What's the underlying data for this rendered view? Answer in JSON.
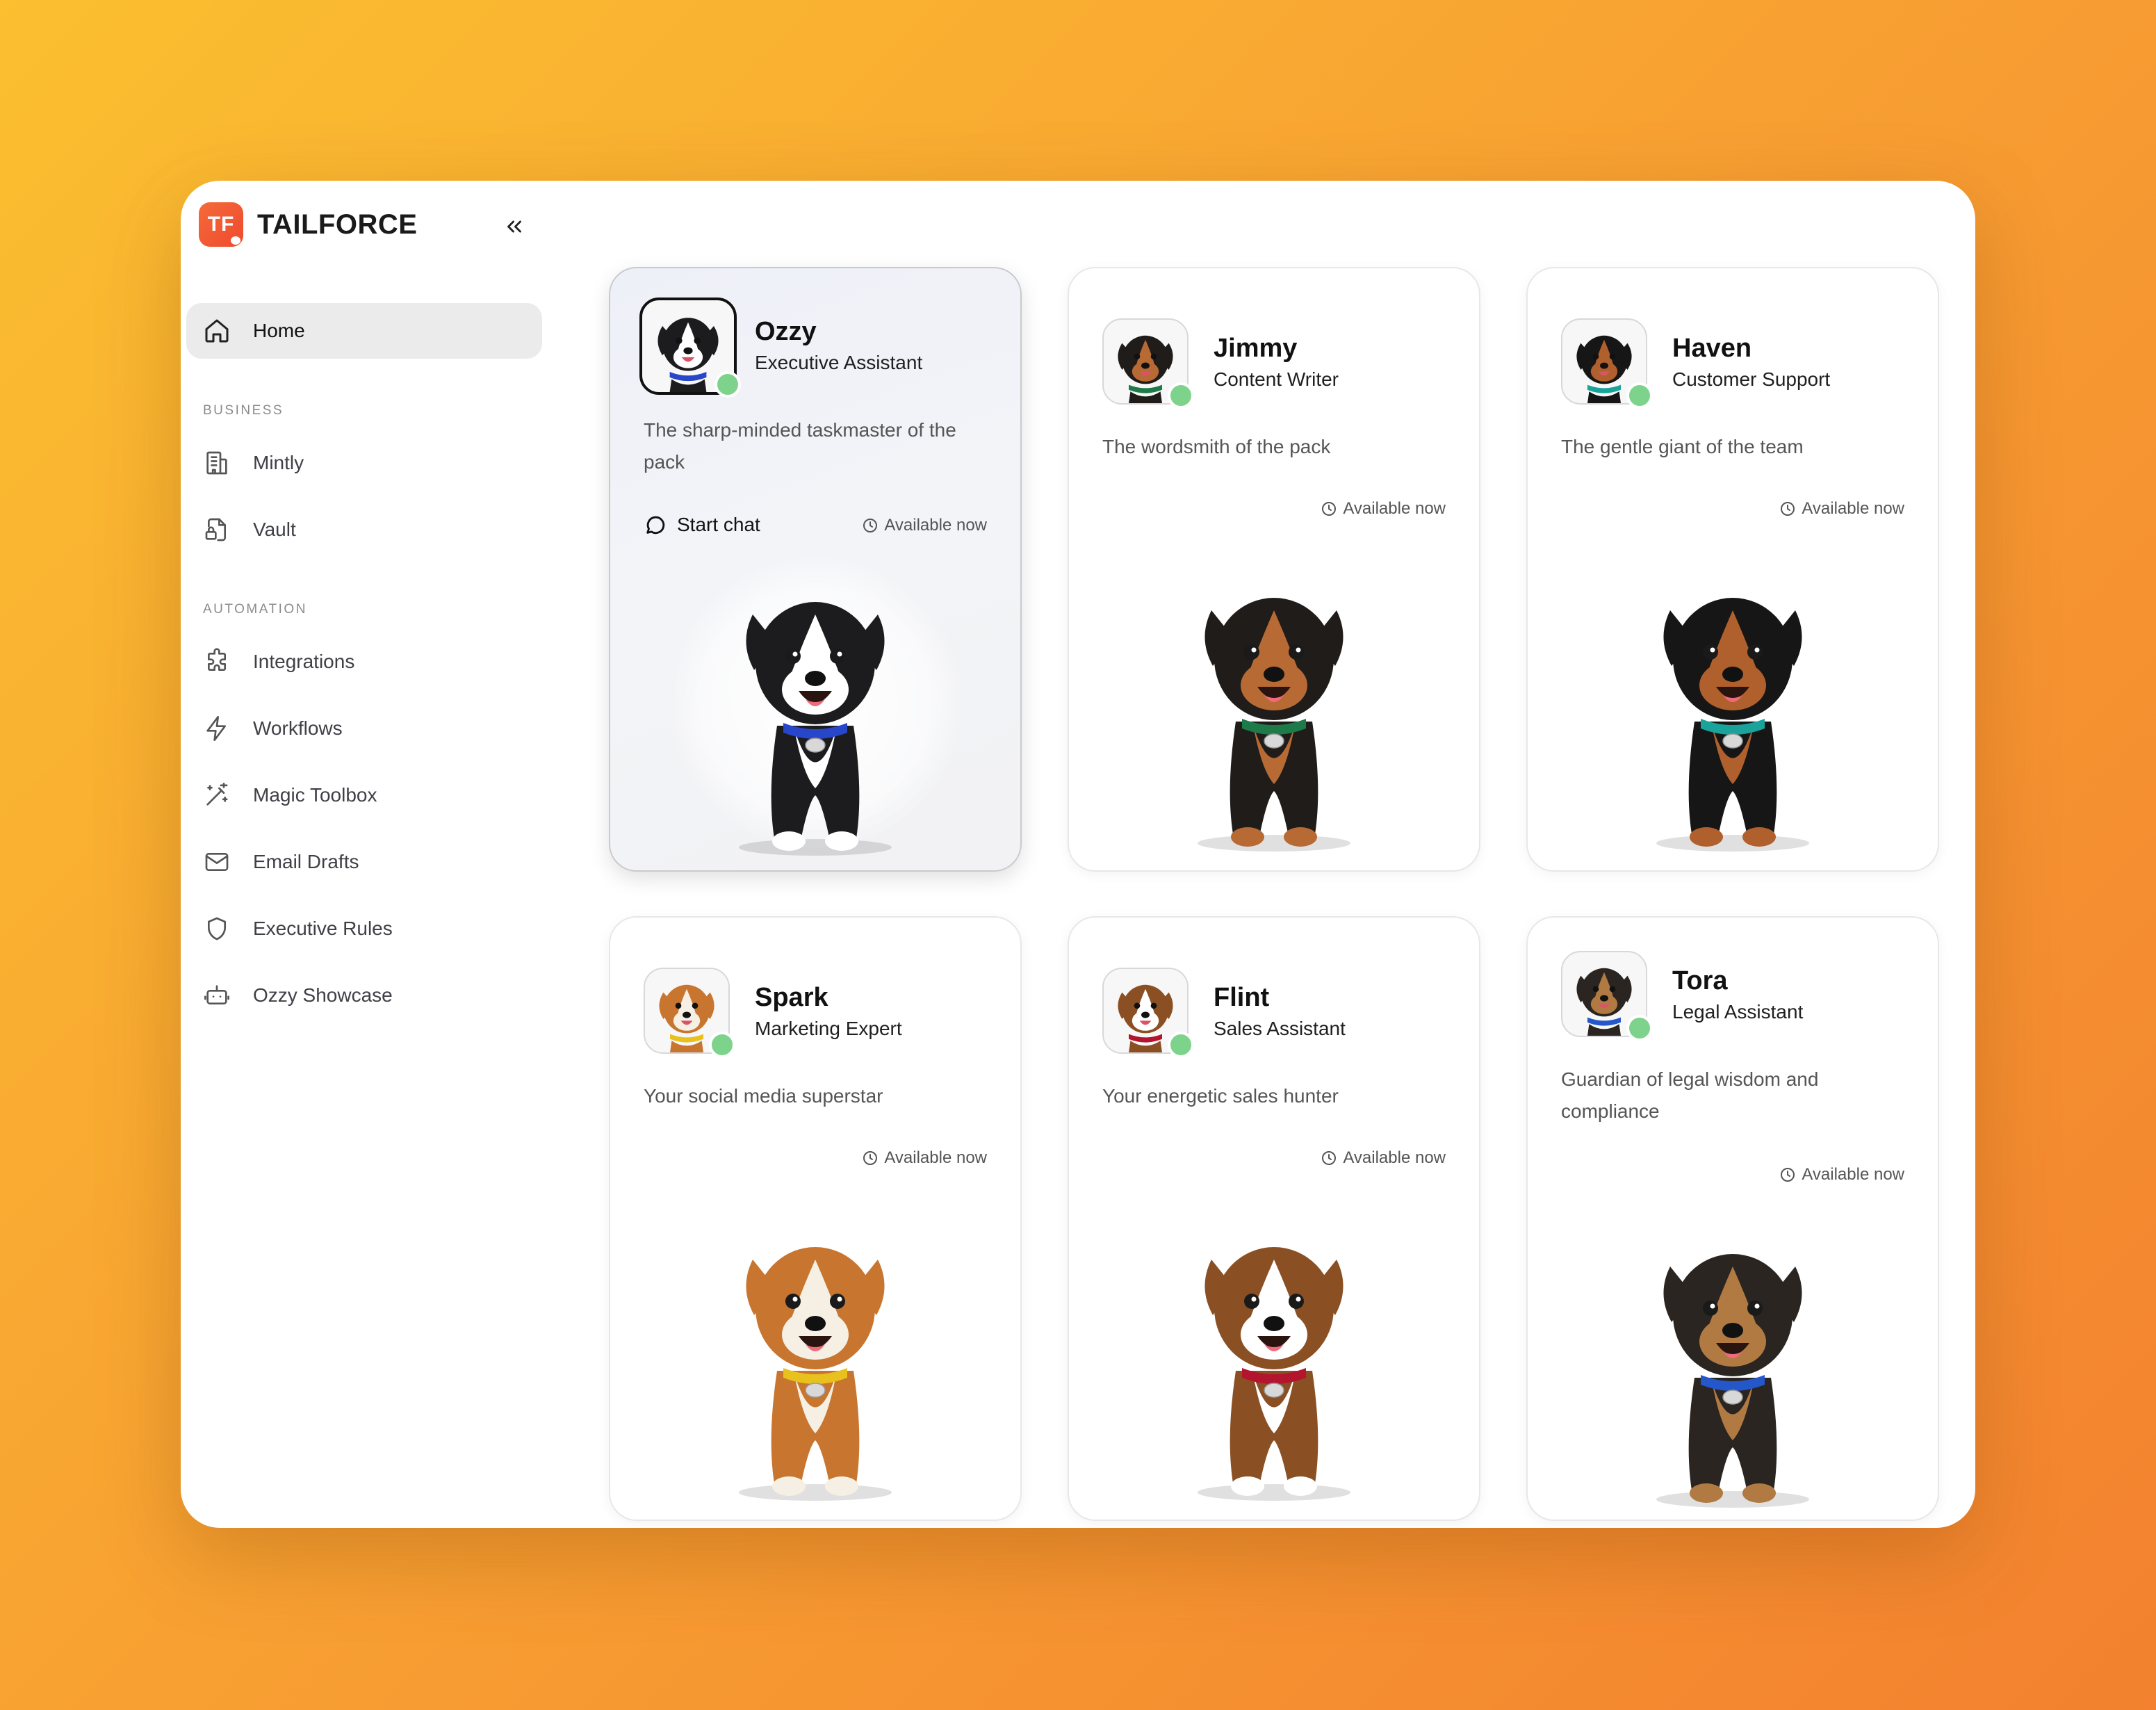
{
  "brand": {
    "logo_text": "TF",
    "name": "TAILFORCE"
  },
  "sidebar": {
    "collapse_icon": "chevrons-left-icon",
    "home": {
      "label": "Home",
      "icon": "home-icon"
    },
    "sections": [
      {
        "label": "BUSINESS",
        "items": [
          {
            "label": "Mintly",
            "icon": "building-icon"
          },
          {
            "label": "Vault",
            "icon": "file-lock-icon"
          }
        ]
      },
      {
        "label": "AUTOMATION",
        "items": [
          {
            "label": "Integrations",
            "icon": "puzzle-icon"
          },
          {
            "label": "Workflows",
            "icon": "lightning-icon"
          },
          {
            "label": "Magic Toolbox",
            "icon": "magic-wand-icon"
          },
          {
            "label": "Email Drafts",
            "icon": "mail-icon"
          },
          {
            "label": "Executive Rules",
            "icon": "shield-icon"
          },
          {
            "label": "Ozzy Showcase",
            "icon": "bot-icon"
          }
        ]
      }
    ]
  },
  "agents": [
    {
      "name": "Ozzy",
      "role": "Executive Assistant",
      "description": "The sharp-minded taskmaster of the pack",
      "availability": "Available now",
      "chat_label": "Start chat",
      "active": true,
      "colors": {
        "coat": "#1c1c1e",
        "accent": "#ffffff",
        "collar": "#2746c9"
      }
    },
    {
      "name": "Jimmy",
      "role": "Content Writer",
      "description": "The wordsmith of the pack",
      "availability": "Available now",
      "colors": {
        "coat": "#1f1c1a",
        "accent": "#b86a35",
        "collar": "#1f7a4a"
      }
    },
    {
      "name": "Haven",
      "role": "Customer Support",
      "description": "The gentle giant of the team",
      "availability": "Available now",
      "colors": {
        "coat": "#161616",
        "accent": "#b0602d",
        "collar": "#1aa39a"
      }
    },
    {
      "name": "Spark",
      "role": "Marketing Expert",
      "description": "Your social media superstar",
      "availability": "Available now",
      "colors": {
        "coat": "#c8752f",
        "accent": "#f6efe4",
        "collar": "#e8c11e"
      }
    },
    {
      "name": "Flint",
      "role": "Sales Assistant",
      "description": "Your energetic sales hunter",
      "availability": "Available now",
      "colors": {
        "coat": "#8a5024",
        "accent": "#ffffff",
        "collar": "#b3142e"
      }
    },
    {
      "name": "Tora",
      "role": "Legal Assistant",
      "description": "Guardian of legal wisdom and compliance",
      "availability": "Available now",
      "colors": {
        "coat": "#2a2521",
        "accent": "#b07a42",
        "collar": "#2457c9"
      }
    }
  ]
}
